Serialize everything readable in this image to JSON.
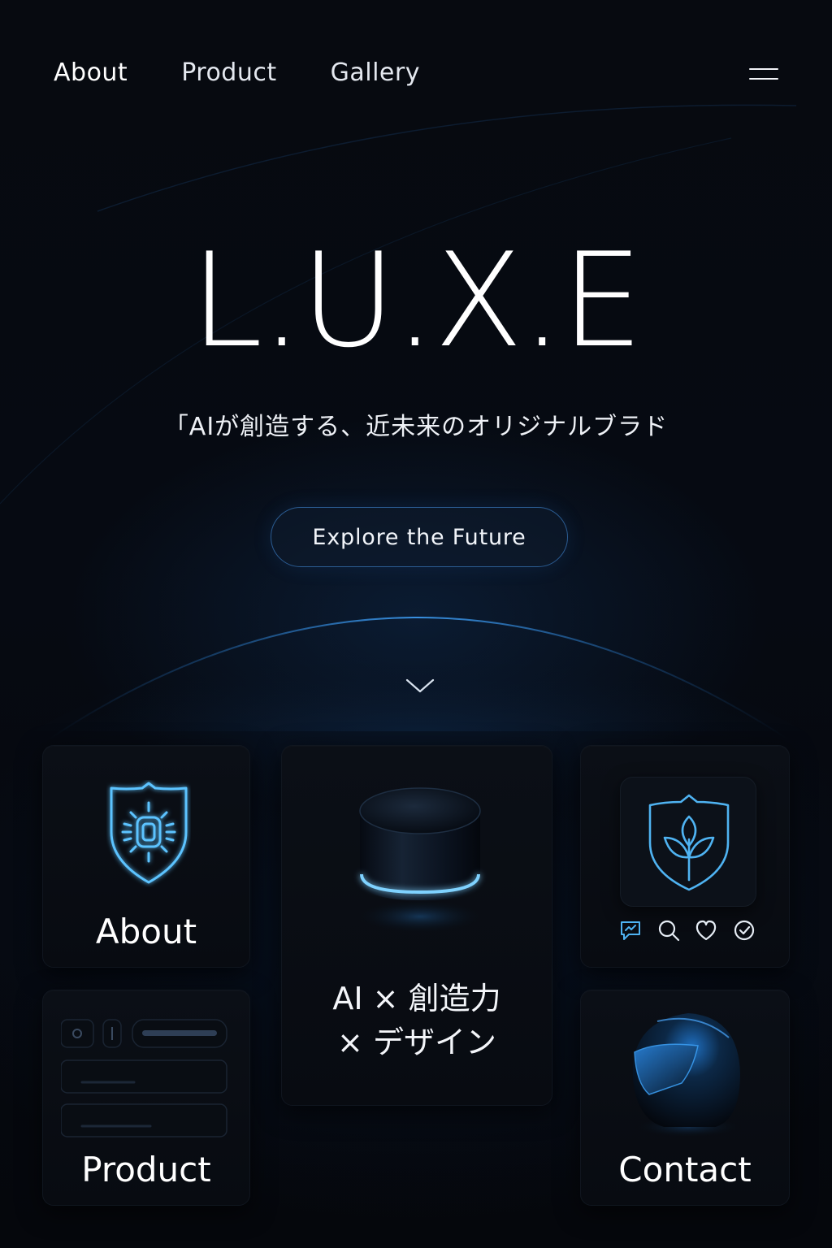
{
  "nav": {
    "links": [
      "About",
      "Product",
      "Gallery"
    ],
    "menu_icon": "hamburger-icon"
  },
  "hero": {
    "title": "L.U.X.E",
    "subtitle": "「AIが創造する、近未来のオリジナルブラド",
    "cta_label": "Explore the Future",
    "scroll_icon": "chevron-down-icon"
  },
  "cards": {
    "about": {
      "label": "About",
      "icon": "shield-chip-icon"
    },
    "center": {
      "line1": "AI × 創造力",
      "line2": "× デザイン",
      "image": "smart-speaker-device"
    },
    "feature": {
      "icon": "shield-leaf-icon",
      "mini_icons": [
        "chat-icon",
        "search-icon",
        "heart-icon",
        "check-circle-icon"
      ]
    },
    "product": {
      "label": "Product",
      "image": "ui-mockup"
    },
    "contact": {
      "label": "Contact",
      "image": "helmet-device"
    }
  },
  "colors": {
    "background": "#05070c",
    "accent": "#4fb6ff",
    "card": "#0a0e14"
  }
}
